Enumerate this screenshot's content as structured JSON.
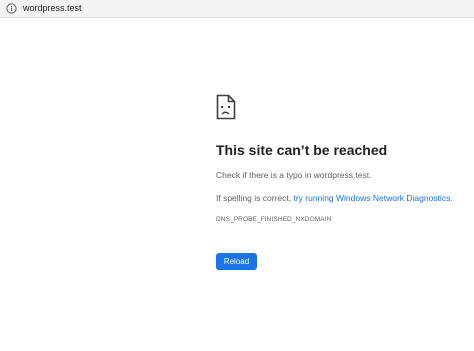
{
  "address_bar": {
    "icon": "info-icon",
    "url": "wordpress.test"
  },
  "error": {
    "icon": "sad-page-icon",
    "title": "This site can’t be reached",
    "message1": "Check if there is a typo in wordpress.test.",
    "message2_prefix": "If spelling is correct, ",
    "message2_link": "try running Windows Network Diagnostics",
    "message2_suffix": ".",
    "code": "DNS_PROBE_FINISHED_NXDOMAIN",
    "reload_label": "Reload"
  },
  "colors": {
    "accent": "#1a73e8",
    "text": "#202124",
    "secondary": "#5f6368"
  }
}
